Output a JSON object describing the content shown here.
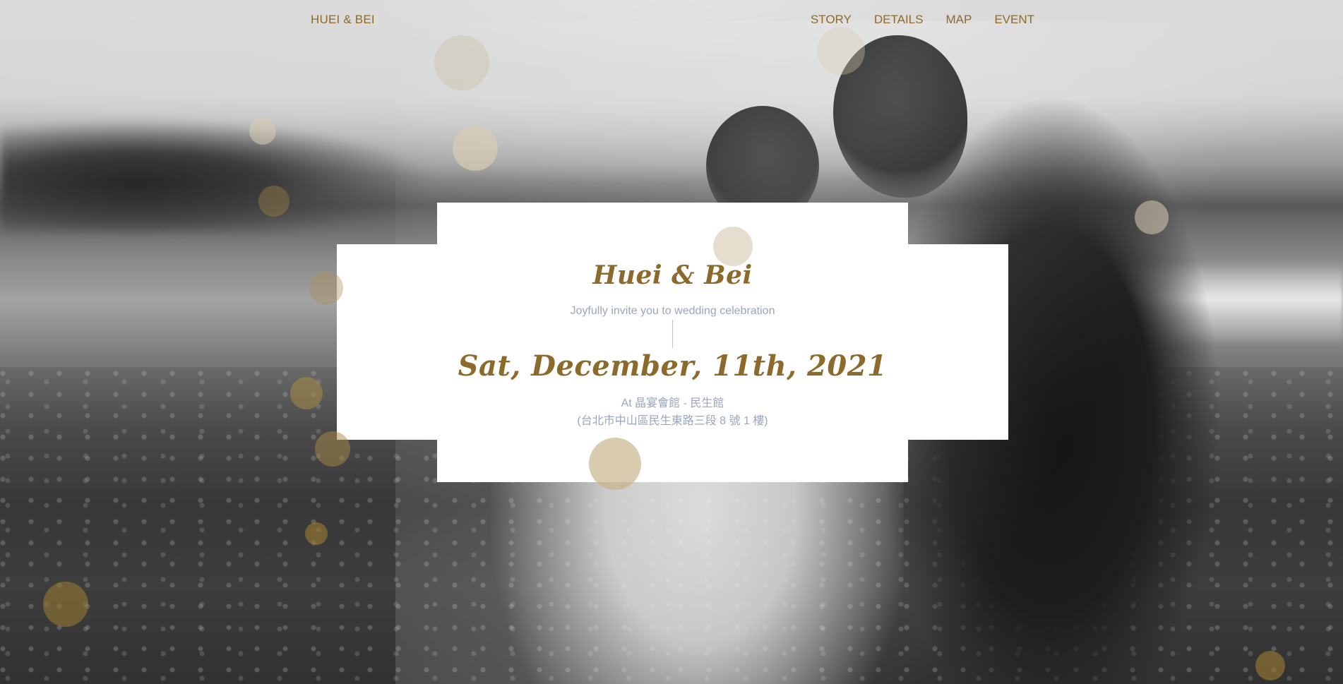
{
  "nav": {
    "brand": "HUEI & BEI",
    "items": [
      {
        "label": "STORY"
      },
      {
        "label": "DETAILS"
      },
      {
        "label": "MAP"
      },
      {
        "label": "EVENT"
      }
    ]
  },
  "invitation": {
    "couple": "Huei & Bei",
    "invite_text": "Joyfully invite you to wedding celebration",
    "date": "Sat, December, 11th, 2021",
    "venue": "At 晶宴會館 - 民生館",
    "address": "(台北市中山區民生東路三段 8 號 1 樓)"
  },
  "colors": {
    "accent_gold": "#8b6a2b",
    "muted_text": "#9aa7bb",
    "card_bg": "#ffffff"
  }
}
